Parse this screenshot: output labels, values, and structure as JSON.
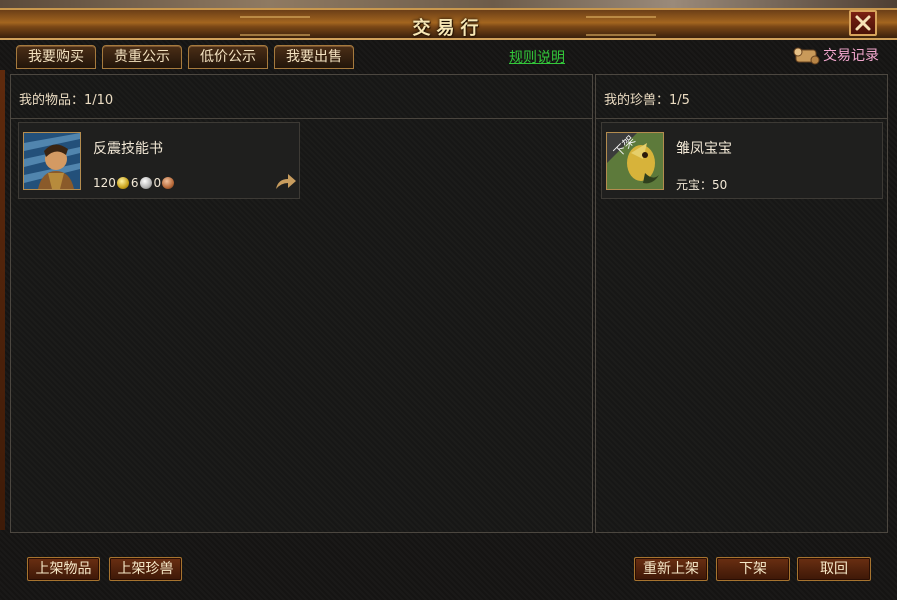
{
  "window": {
    "title": "交易行"
  },
  "tabs": [
    {
      "label": "我要购买"
    },
    {
      "label": "贵重公示"
    },
    {
      "label": "低价公示"
    },
    {
      "label": "我要出售"
    }
  ],
  "rules_link": "规则说明",
  "trade_record": "交易记录",
  "items_panel": {
    "header": "我的物品：1/10",
    "items": [
      {
        "name": "反震技能书",
        "gold": "120",
        "silver": "6",
        "copper": "0",
        "icon": "warrior-portrait-icon"
      }
    ]
  },
  "pets_panel": {
    "header": "我的珍兽：1/5",
    "items": [
      {
        "name": "雏凤宝宝",
        "price": "元宝：50",
        "badge": "下架",
        "icon": "phoenix-pet-icon"
      }
    ]
  },
  "buttons": {
    "list_item": "上架物品",
    "list_pet": "上架珍兽",
    "relist": "重新上架",
    "delist": "下架",
    "cancel": "取回"
  },
  "colors": {
    "accent_gold": "#d7a35b",
    "link_green": "#33c63a",
    "record_pink": "#f3a7ce",
    "button_bg": "#5a260e"
  }
}
